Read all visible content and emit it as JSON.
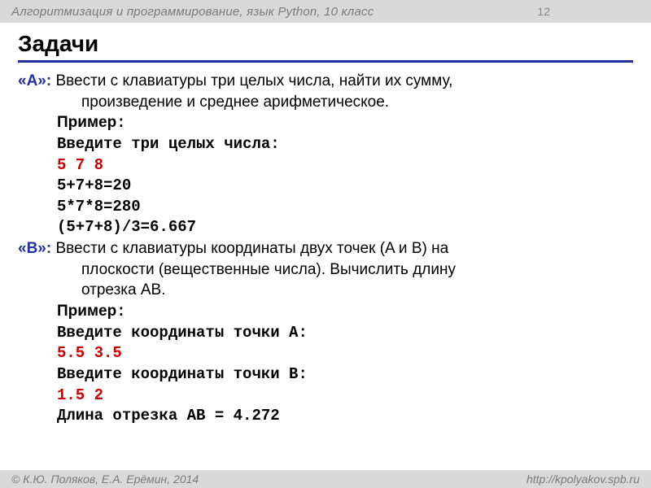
{
  "header": {
    "course": "Алгоритмизация и программирование, язык Python, 10 класс",
    "page_number": "12"
  },
  "title": "Задачи",
  "taskA": {
    "label": "«A»:",
    "text1": " Ввести с клавиатуры три целых числа, найти их сумму,",
    "text2": "произведение и среднее арифметическое.",
    "example_label": "Пример",
    "colon": ":",
    "prompt": "Введите три целых числа:",
    "input": "5 7 8",
    "out1": "5+7+8=20",
    "out2": "5*7*8=280",
    "out3": "(5+7+8)/3=6.667"
  },
  "taskB": {
    "label": "«B»:",
    "text1": " Ввести с клавиатуры координаты двух точек (A и B) на",
    "text2": "плоскости (вещественные числа). Вычислить длину",
    "text3": "отрезка AB.",
    "example_label": "Пример",
    "colon": ":",
    "promptA": "Введите координаты точки A:",
    "inputA": "5.5 3.5",
    "promptB": "Введите координаты точки B:",
    "inputB": "1.5 2",
    "result": "Длина отрезка AB = 4.272"
  },
  "footer": {
    "left": "© К.Ю. Поляков, Е.А. Ерёмин, 2014",
    "right": "http://kpolyakov.spb.ru"
  }
}
